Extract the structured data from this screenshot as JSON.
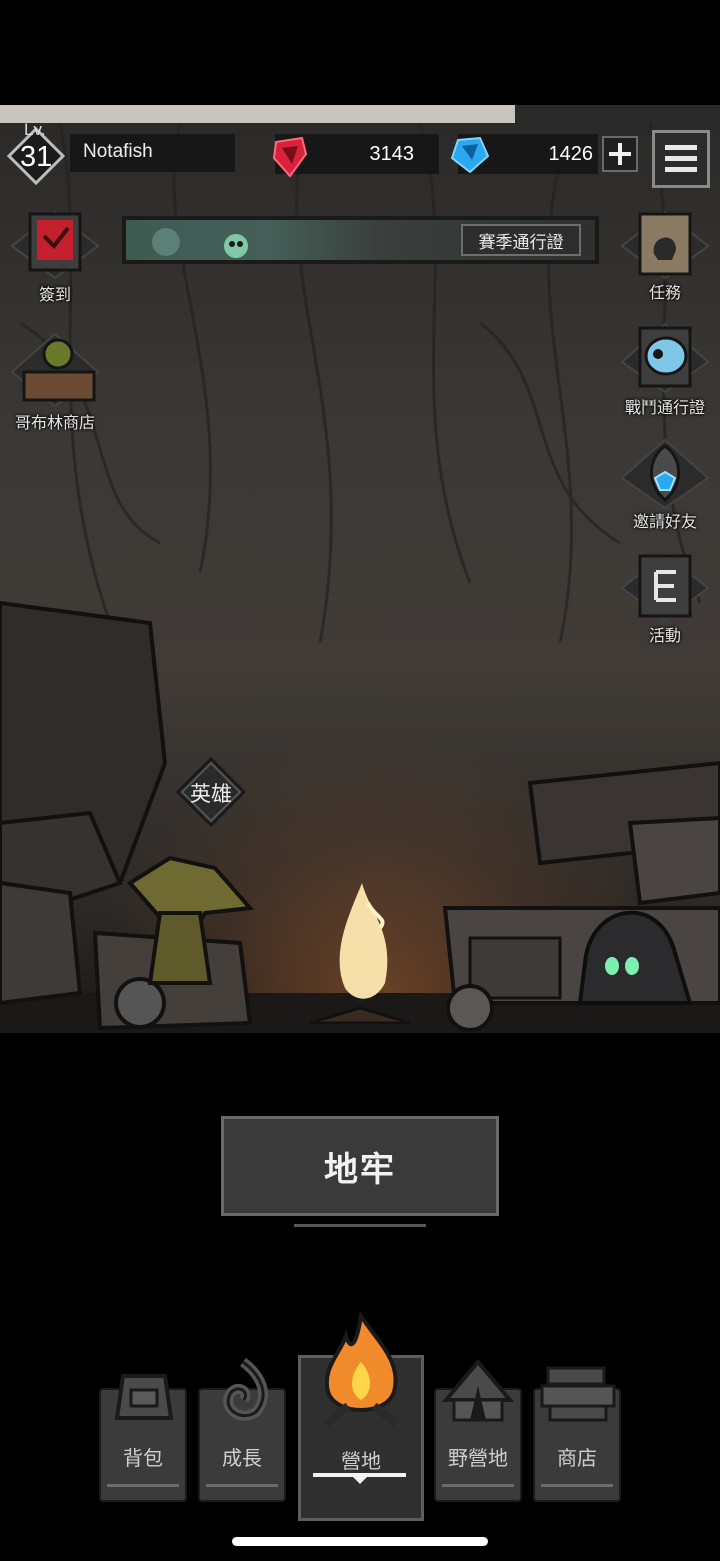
{
  "loading": {
    "progress": 0.715
  },
  "header": {
    "level_prefix": "Lv.",
    "level": "31",
    "player_name": "Notafish",
    "red_gems": "3143",
    "blue_gems": "1426",
    "add_label": "+"
  },
  "season": {
    "pass_label": "賽季通行證"
  },
  "left_icons": [
    {
      "label": "簽到",
      "icon": "checkin-icon"
    },
    {
      "label": "哥布林商店",
      "icon": "goblin-shop-icon"
    }
  ],
  "right_icons": [
    {
      "label": "任務",
      "icon": "quest-icon"
    },
    {
      "label": "戰鬥通行證",
      "icon": "battle-pass-icon"
    },
    {
      "label": "邀請好友",
      "icon": "invite-friends-icon"
    },
    {
      "label": "活動",
      "icon": "events-icon"
    }
  ],
  "hero": {
    "label": "英雄"
  },
  "main": {
    "dungeon_label": "地牢"
  },
  "nav": {
    "items": [
      {
        "label": "背包",
        "icon": "backpack-icon"
      },
      {
        "label": "成長",
        "icon": "growth-icon"
      },
      {
        "label": "營地",
        "icon": "campfire-icon",
        "active": true
      },
      {
        "label": "野營地",
        "icon": "tent-icon"
      },
      {
        "label": "商店",
        "icon": "shop-icon"
      }
    ]
  },
  "colors": {
    "red_gem": "#e0263a",
    "blue_gem": "#2aa8f0",
    "fire": "#f08a2a",
    "panel": "#3a3a3a"
  }
}
